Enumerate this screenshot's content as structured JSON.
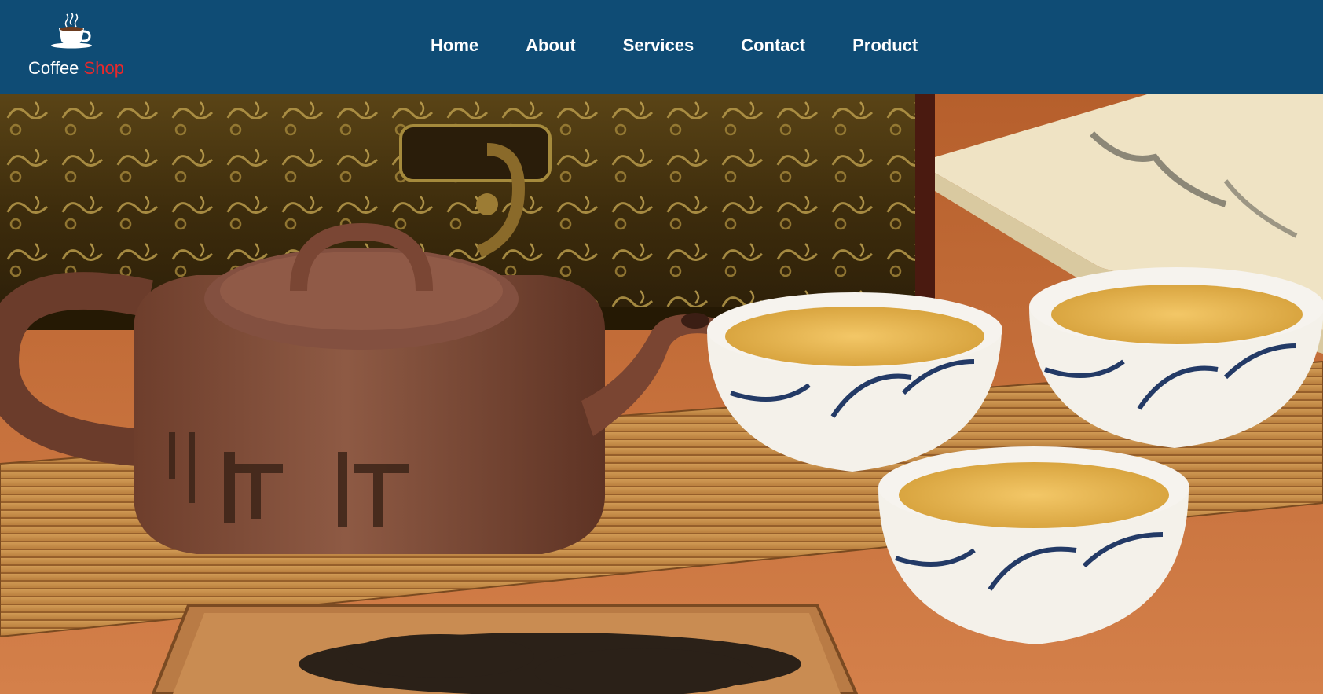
{
  "logo": {
    "word1": "Coffee",
    "word2": "Shop",
    "icon": "coffee-cup-icon"
  },
  "nav": {
    "items": [
      {
        "label": "Home"
      },
      {
        "label": "About"
      },
      {
        "label": "Services"
      },
      {
        "label": "Contact"
      },
      {
        "label": "Product"
      }
    ]
  },
  "hero": {
    "image": "teapot-and-tea-cups-photo"
  },
  "colors": {
    "header_bg": "#0f4c75",
    "nav_text": "#ffffff",
    "logo_accent": "#e8282b"
  }
}
